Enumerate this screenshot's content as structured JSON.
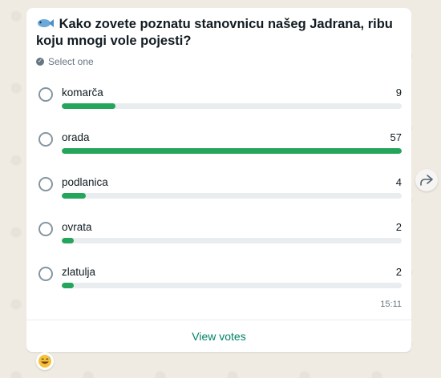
{
  "poll": {
    "question": "Kako zovete poznatu stanovnicu našeg Jadrana, ribu koju mnogi vole pojesti?",
    "hint": "Select one",
    "options": [
      {
        "label": "komarča",
        "count": "9",
        "fraction": 0.158
      },
      {
        "label": "orada",
        "count": "57",
        "fraction": 1.0
      },
      {
        "label": "podlanica",
        "count": "4",
        "fraction": 0.07
      },
      {
        "label": "ovrata",
        "count": "2",
        "fraction": 0.035
      },
      {
        "label": "zlatulja",
        "count": "2",
        "fraction": 0.035
      }
    ],
    "time": "15:11",
    "view_votes": "View votes",
    "bar_color": "#25a45b"
  },
  "icons": {
    "question_icon": "fish-icon",
    "hint_icon": "check-circle-icon",
    "forward": "forward-arrow-icon",
    "reaction": "grinning-sweat-emoji"
  }
}
